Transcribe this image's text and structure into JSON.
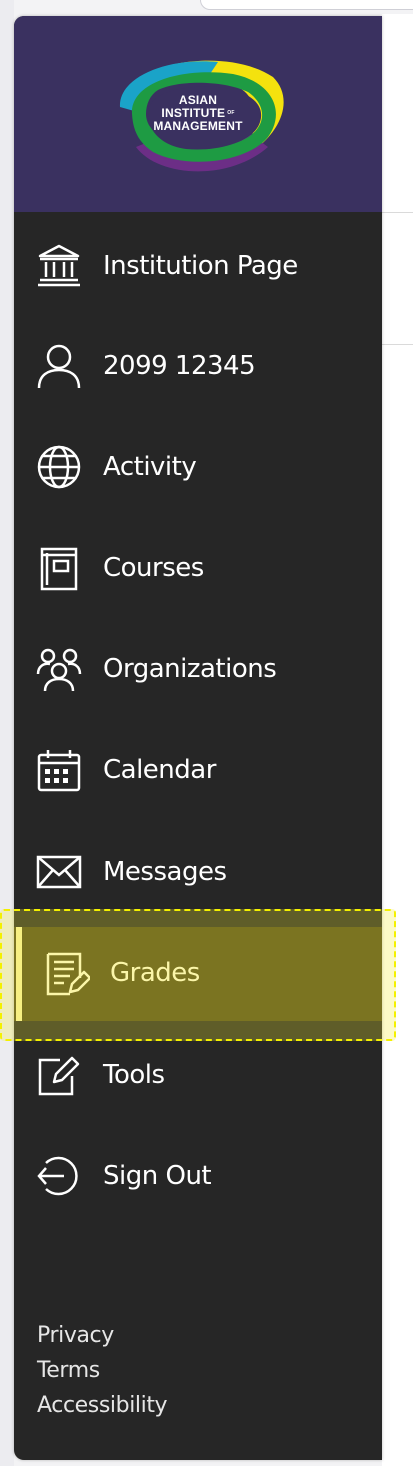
{
  "brand": {
    "logo_line1": "ASIAN",
    "logo_line2": "INSTITUTE",
    "logo_of": "OF",
    "logo_line3": "MANAGEMENT",
    "colors": {
      "purple": "#3a3160",
      "green": "#1e9b43",
      "yellow": "#f4e20e",
      "teal": "#1aa3c8",
      "violet": "#6c2e86"
    }
  },
  "nav": {
    "items": [
      {
        "label": "Institution Page",
        "icon": "institution-icon"
      },
      {
        "label": "2099 12345",
        "icon": "user-icon"
      },
      {
        "label": "Activity",
        "icon": "globe-icon"
      },
      {
        "label": "Courses",
        "icon": "courses-icon"
      },
      {
        "label": "Organizations",
        "icon": "organizations-icon"
      },
      {
        "label": "Calendar",
        "icon": "calendar-icon"
      },
      {
        "label": "Messages",
        "icon": "envelope-icon"
      },
      {
        "label": "Grades",
        "icon": "grades-icon",
        "active": true
      },
      {
        "label": "Tools",
        "icon": "tools-icon"
      },
      {
        "label": "Sign Out",
        "icon": "sign-out-icon"
      }
    ],
    "active_color": "#fbf6a9"
  },
  "footer": {
    "links": [
      "Privacy",
      "Terms",
      "Accessibility"
    ]
  }
}
